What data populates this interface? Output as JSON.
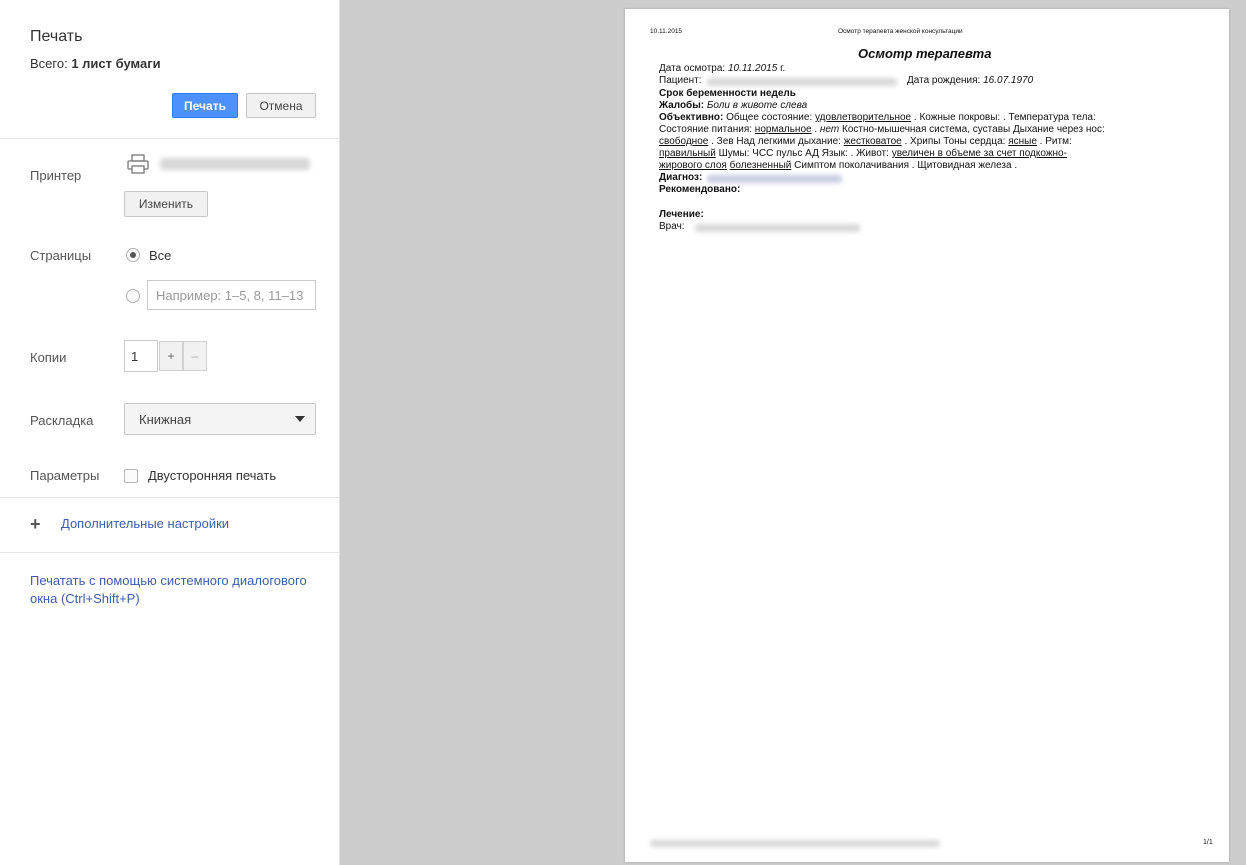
{
  "panel": {
    "title": "Печать",
    "total_label": "Всего:",
    "total_value": "1 лист бумаги",
    "print_button": "Печать",
    "cancel_button": "Отмена",
    "printer_label": "Принтер",
    "change_button": "Изменить",
    "pages_label": "Страницы",
    "pages_all": "Все",
    "pages_placeholder": "Например: 1–5, 8, 11–13",
    "copies_label": "Копии",
    "copies_value": "1",
    "copies_plus": "+",
    "copies_minus": "–",
    "layout_label": "Раскладка",
    "layout_value": "Книжная",
    "params_label": "Параметры",
    "duplex_label": "Двусторонняя печать",
    "advanced": "Дополнительные настройки",
    "system_dialog": "Печатать с помощью системного диалогового окна (Ctrl+Shift+P)"
  },
  "doc": {
    "header_date": "10.11.2015",
    "header_title": "Осмотр терапевта женской консультации",
    "title": "Осмотр терапевта",
    "date_label": "Дата осмотра:",
    "date_value": "10.11.2015",
    "date_suffix": "г.",
    "patient_label": "Пациент:",
    "dob_label": "Дата рождения:",
    "dob_value": "16.07.1970",
    "pregnancy": "Срок беременности   недель",
    "complaints_label": "Жалобы:",
    "complaints_value": "Боли в животе слева",
    "obj_label": "Объективно:",
    "obj_general": "Общее состояние:",
    "obj_general_val": "удовлетворительное",
    "obj_skin": ". Кожные покровы:  . Температура тела:",
    "nutr_label": "Состояние питания:",
    "nutr_val": "нормальное",
    "nutr_sep": ".",
    "nutr_net": "нет",
    "nutr_rest": "Костно-мышечная система, суставы   Дыхание через нос:",
    "breath_val": "свободное",
    "breath_rest": ". Зев   Над легкими дыхание:",
    "lungs_val": "жестковатое",
    "lungs_rest": ". Хрипы   Тоны сердца:",
    "heart_val": "ясные",
    "heart_rest": ". Ритм:",
    "rhythm_val": "правильный",
    "rhythm_rest": "Шумы:   ЧСС   пульс   АД   Язык:  . Живот:",
    "belly_val": "увеличен в объеме за счет подкожно-",
    "belly_val2": "жирового слоя",
    "belly_val3": "болезненный",
    "belly_rest": "Симптом поколачивания  . Щитовидная железа  .",
    "diag_label": "Диагноз:",
    "recommend_label": "Рекомендовано:",
    "treatment_label": "Лечение:",
    "doctor_label": "Врач:",
    "page_number": "1/1"
  }
}
